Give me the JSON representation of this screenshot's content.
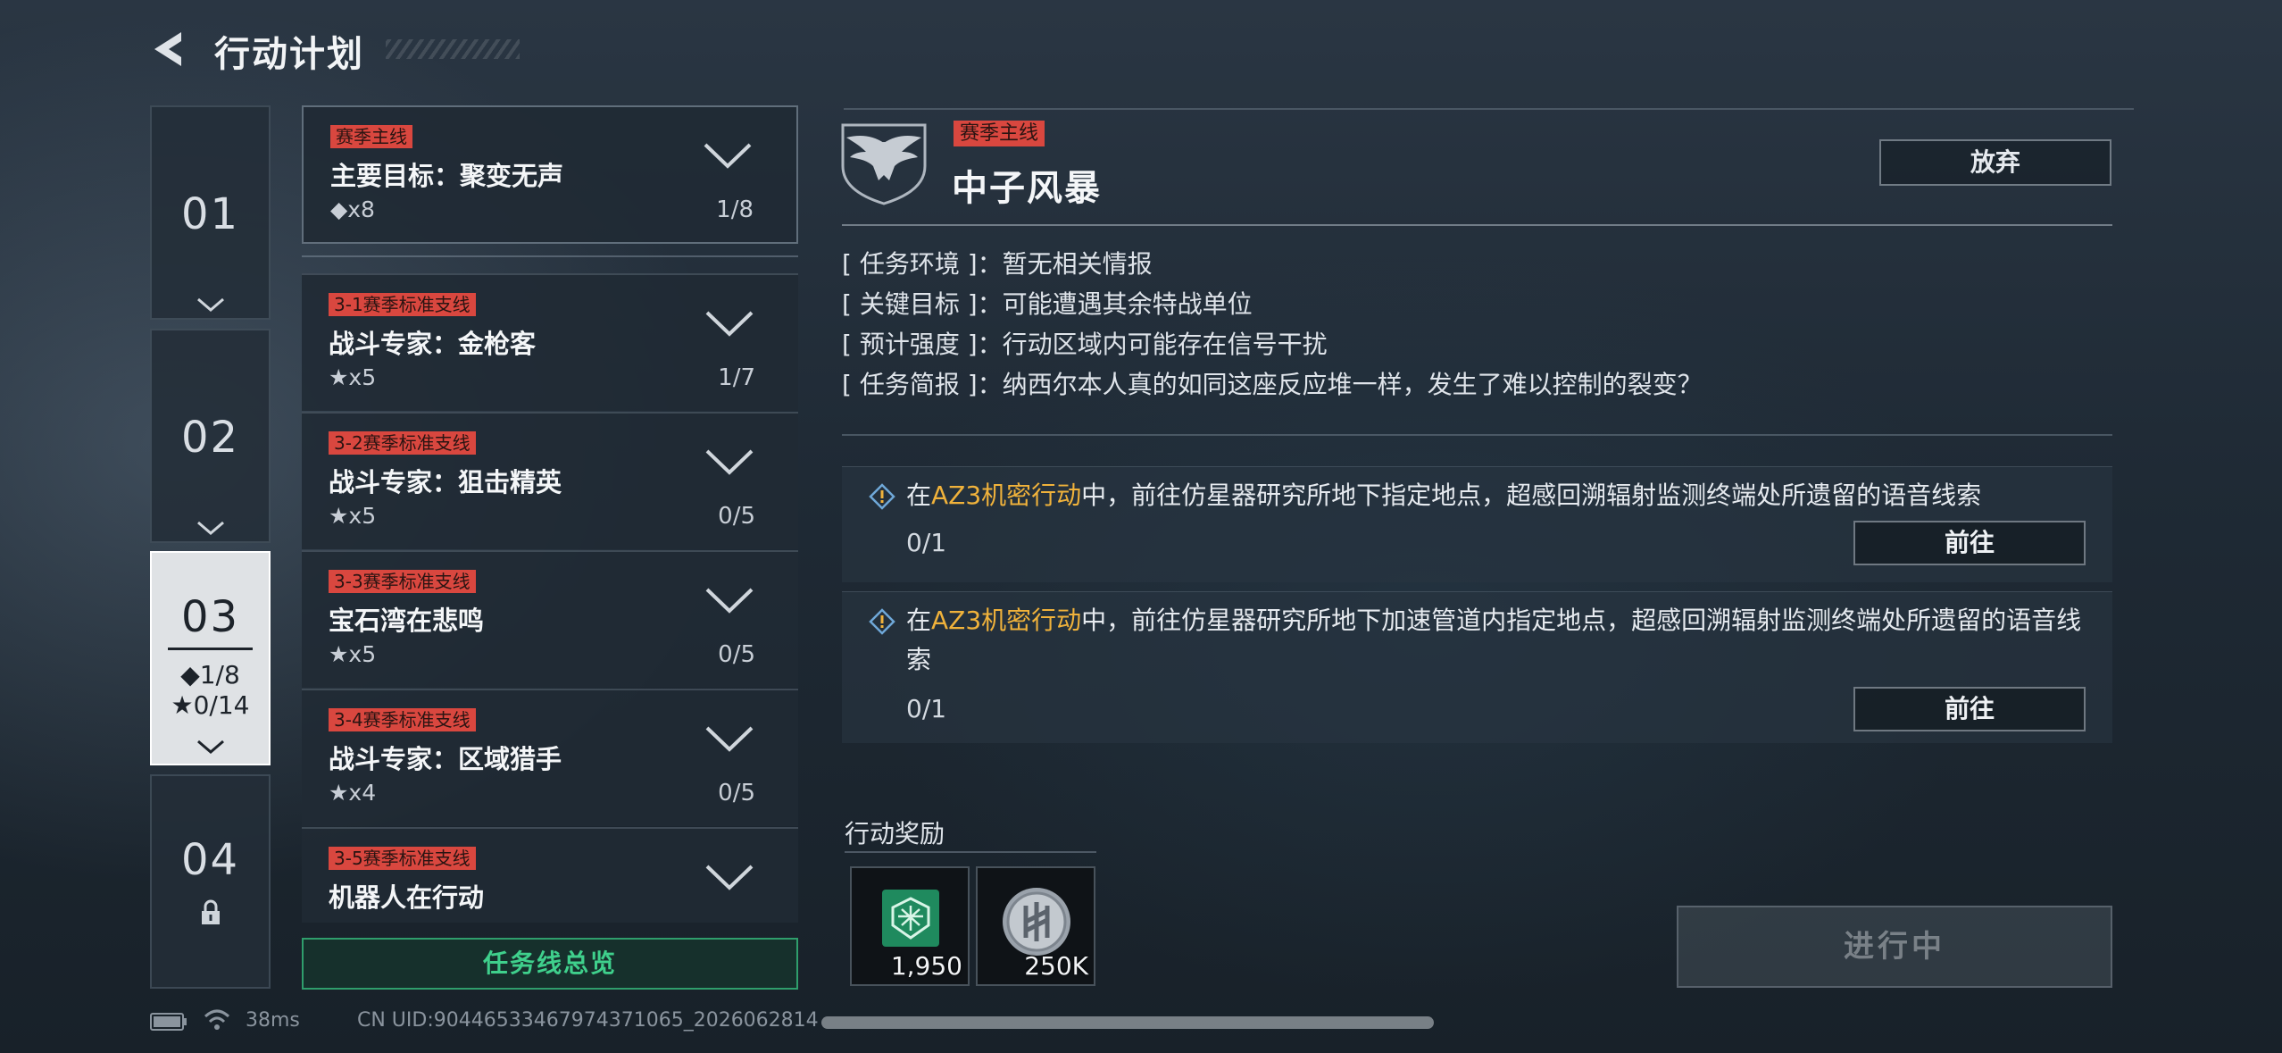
{
  "header": {
    "title": "行动计划"
  },
  "chapters": [
    {
      "number": "01"
    },
    {
      "number": "02"
    },
    {
      "number": "03",
      "diamonds": "◆1/8",
      "stars": "★0/14"
    },
    {
      "number": "04"
    }
  ],
  "missions": [
    {
      "tag": "赛季主线",
      "name": "主要目标：聚变无声",
      "count": "◆x8",
      "progress": "1/8"
    },
    {
      "tag": "3-1赛季标准支线",
      "name": "战斗专家：金枪客",
      "count": "★x5",
      "progress": "1/7"
    },
    {
      "tag": "3-2赛季标准支线",
      "name": "战斗专家：狙击精英",
      "count": "★x5",
      "progress": "0/5"
    },
    {
      "tag": "3-3赛季标准支线",
      "name": "宝石湾在悲鸣",
      "count": "★x5",
      "progress": "0/5"
    },
    {
      "tag": "3-4赛季标准支线",
      "name": "战斗专家：区域猎手",
      "count": "★x4",
      "progress": "0/5"
    },
    {
      "tag": "3-5赛季标准支线",
      "name": "机器人在行动",
      "count": "",
      "progress": ""
    }
  ],
  "overview_label": "任务线总览",
  "detail": {
    "tag": "赛季主线",
    "title": "中子风暴",
    "abandon_label": "放弃",
    "info": [
      {
        "label": "[ 任务环境 ]：",
        "value": "暂无相关情报"
      },
      {
        "label": "[ 关键目标 ]：",
        "value": "可能遭遇其余特战单位"
      },
      {
        "label": "[ 预计强度 ]：",
        "value": "行动区域内可能存在信号干扰"
      },
      {
        "label": "[ 任务简报 ]：",
        "value": "纳西尔本人真的如同这座反应堆一样，发生了难以控制的裂变？"
      }
    ],
    "objectives": [
      {
        "prefix": "在",
        "highlight": "AZ3机密行动",
        "suffix": "中，前往仿星器研究所地下指定地点，超感回溯辐射监测终端处所遗留的语音线索",
        "progress": "0/1",
        "button": "前往"
      },
      {
        "prefix": "在",
        "highlight": "AZ3机密行动",
        "suffix": "中，前往仿星器研究所地下加速管道内指定地点，超感回溯辐射监测终端处所遗留的语音线索",
        "progress": "0/1",
        "button": "前往"
      }
    ],
    "reward_title": "行动奖励",
    "rewards": [
      {
        "icon": "green-emblem-icon",
        "amount": "1,950"
      },
      {
        "icon": "silver-coin-icon",
        "amount": "250K"
      }
    ],
    "status_label": "进行中"
  },
  "footer": {
    "ping": "38ms",
    "uid": "CN UID:9044653346797437106​5_2026062814​"
  },
  "colors": {
    "tag_red": "#d9473f",
    "highlight_gold": "#f0b23b",
    "overview_green": "#3fd08c"
  }
}
